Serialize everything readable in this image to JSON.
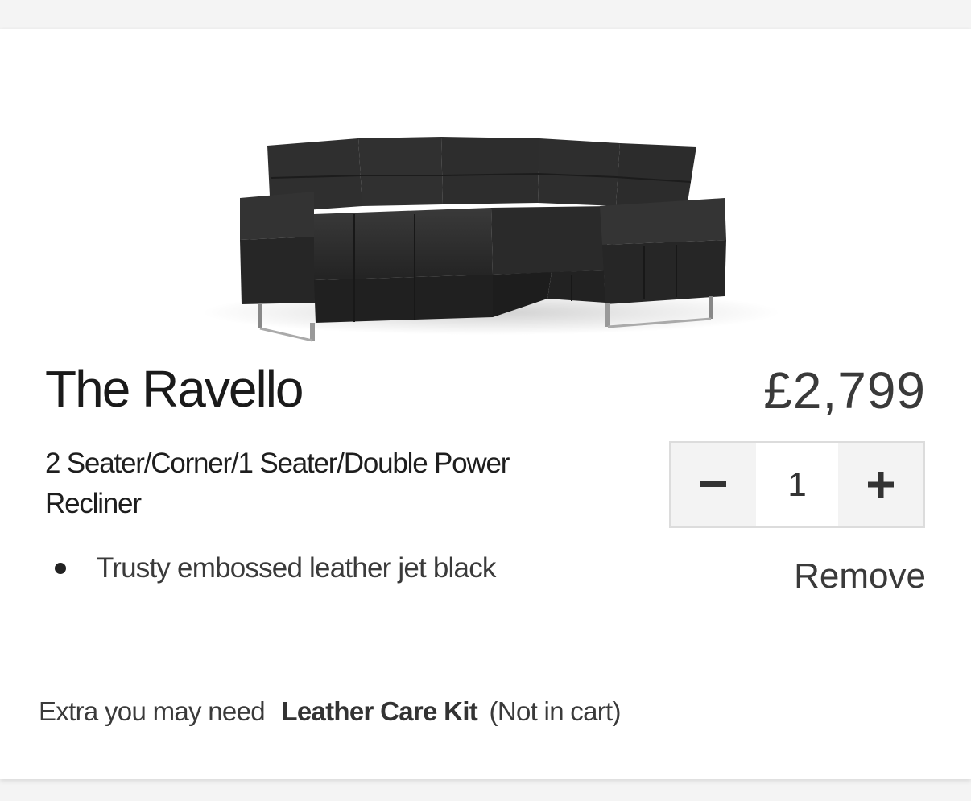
{
  "product": {
    "image_icon": "corner-sofa-image",
    "name": "The Ravello",
    "price": "£2,799",
    "description": "2 Seater/Corner/1 Seater/Double Power Recliner",
    "options": [
      "Trusty embossed leather jet black"
    ]
  },
  "quantity": {
    "decrement_label": "−",
    "value": "1",
    "increment_label": "+"
  },
  "remove_label": "Remove",
  "extras": {
    "prefix": "Extra you may need",
    "item": "Leather Care Kit",
    "status": "(Not in cart)"
  },
  "colors": {
    "sofa": "#2b2b2b",
    "background": "#f4f4f4",
    "card": "#ffffff"
  }
}
